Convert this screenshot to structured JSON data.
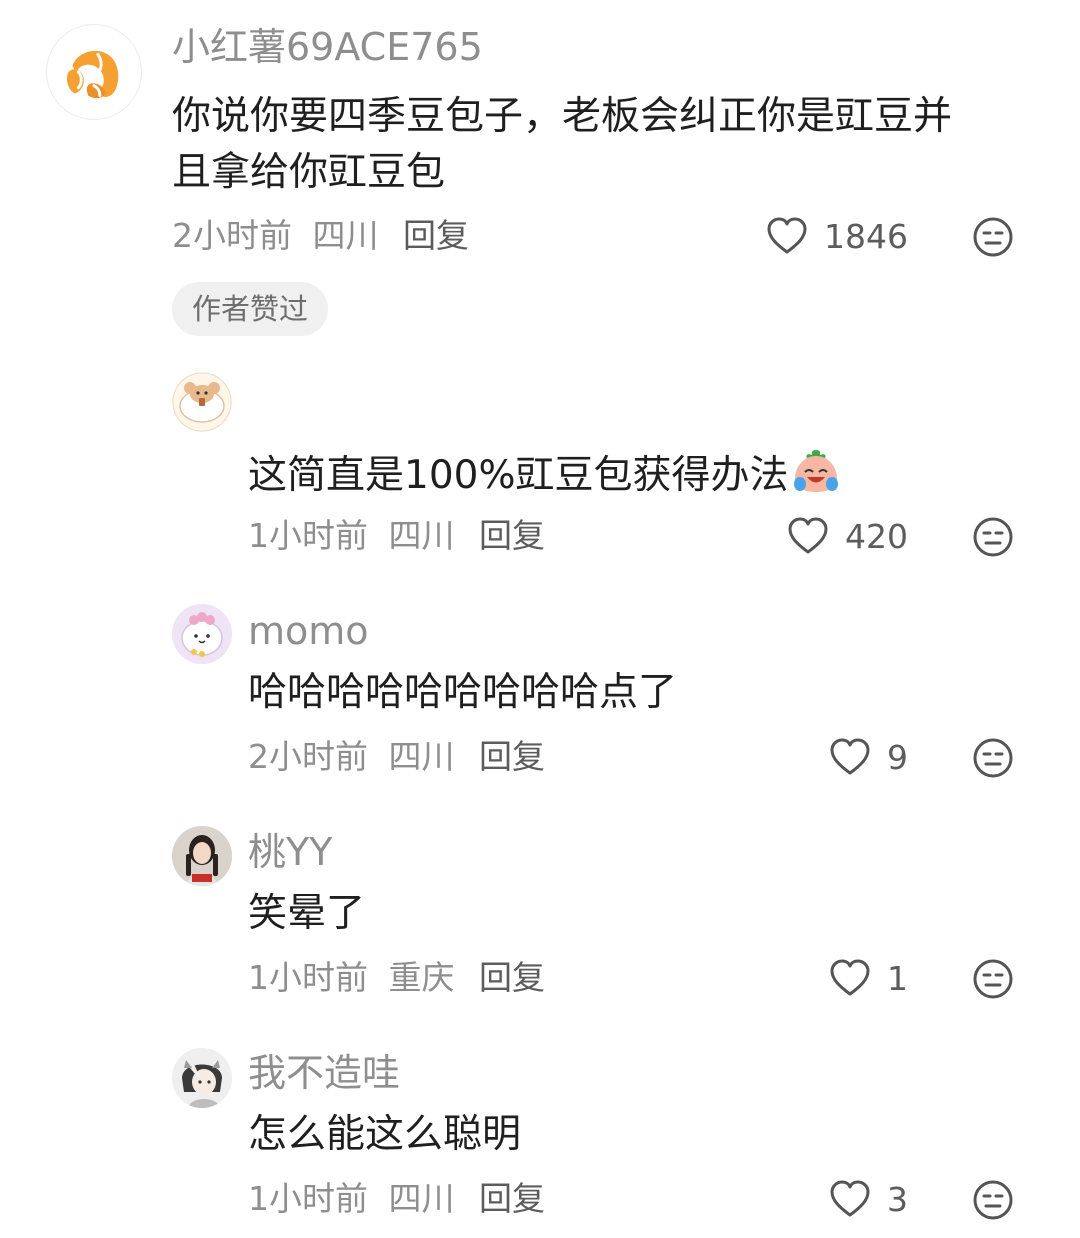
{
  "comments": [
    {
      "username": "小红薯69ACE765",
      "text_line1": "你说你要四季豆包子，老板会纠正你是豇豆并",
      "text_line2": "且拿给你豇豆包",
      "time": "2小时前",
      "location": "四川",
      "reply_label": "回复",
      "likes": "1846",
      "badge": "作者赞过",
      "avatar_icon": "croissant-icon"
    },
    {
      "username": "",
      "text": "这简直是100%豇豆包获得办法",
      "emoji_icon": "crying-laughing-emoji-icon",
      "time": "1小时前",
      "location": "四川",
      "reply_label": "回复",
      "likes": "420",
      "avatar_icon": "cartoon-hamster-icon"
    },
    {
      "username": "momo",
      "text": "哈哈哈哈哈哈哈哈哈点了",
      "time": "2小时前",
      "location": "四川",
      "reply_label": "回复",
      "likes": "9",
      "avatar_icon": "cartoon-dumpling-icon"
    },
    {
      "username": "桃YY",
      "text": "笑晕了",
      "time": "1小时前",
      "location": "重庆",
      "reply_label": "回复",
      "likes": "1",
      "avatar_icon": "girl-photo-icon"
    },
    {
      "username": "我不造哇",
      "text": "怎么能这么聪明",
      "time": "1小时前",
      "location": "四川",
      "reply_label": "回复",
      "likes": "3",
      "avatar_icon": "anime-character-icon"
    }
  ],
  "colors": {
    "muted_text": "#8e8e8e",
    "body_text": "#1f1f1f",
    "badge_bg": "#f0f0f0",
    "croissant": "#f5a030"
  }
}
